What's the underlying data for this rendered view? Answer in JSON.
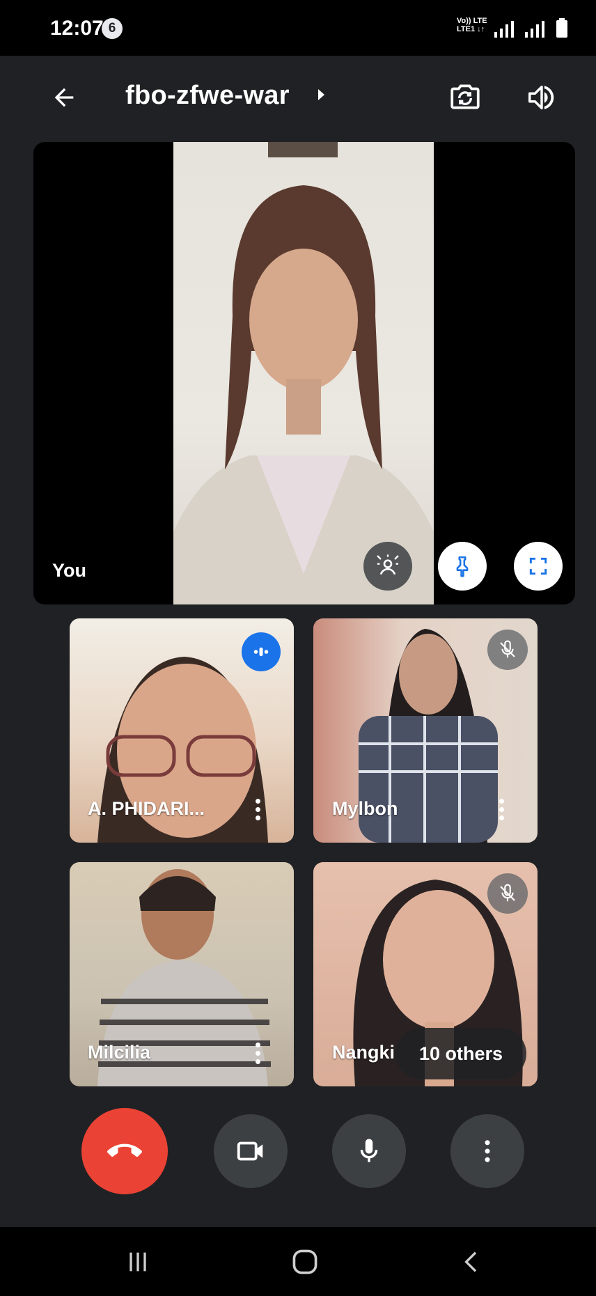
{
  "status_bar": {
    "time": "12:07",
    "notification_count": "6",
    "network_label_top": "Vo)) LTE",
    "network_label_bottom": "LTE1 ↓↑"
  },
  "top_bar": {
    "meeting_code": "fbo-zfwe-war",
    "icons": [
      "back-arrow-icon",
      "switch-camera-icon",
      "speaker-icon"
    ]
  },
  "self_tile": {
    "label": "You"
  },
  "participants": [
    {
      "name": "A. PHIDARI...",
      "speaking": true,
      "muted": false
    },
    {
      "name": "Mylbon",
      "speaking": false,
      "muted": true
    },
    {
      "name": "Milcilia",
      "speaking": false,
      "muted": false
    },
    {
      "name": "Nangki",
      "speaking": false,
      "muted": true
    }
  ],
  "others_chip": {
    "label": "10 others"
  },
  "colors": {
    "background": "#202124",
    "end_call": "#ea4335",
    "control_button": "#3c4043",
    "accent_blue": "#1a73e8"
  }
}
